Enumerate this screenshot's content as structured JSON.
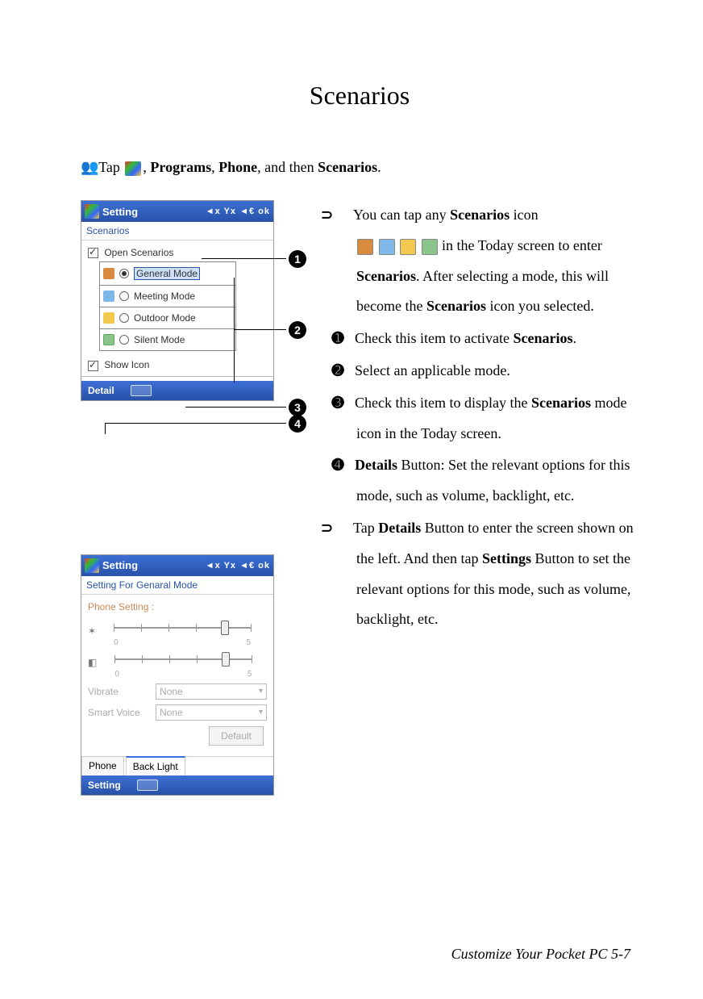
{
  "title": "Scenarios",
  "nav": {
    "tap": "Tap",
    "sep1": ", ",
    "programs": "Programs",
    "sep2": ", ",
    "phone": "Phone",
    "sep3": ", and then ",
    "scenarios": "Scenarios",
    "end": "."
  },
  "device1": {
    "topbar_title": "Setting",
    "tray": "◄x  Yx  ◄€  ok",
    "subhead": "Scenarios",
    "open_label": "Open Scenarios",
    "modes": {
      "general": "General Mode",
      "meeting": "Meeting Mode",
      "outdoor": "Outdoor Mode",
      "silent": "Silent Mode"
    },
    "show_icon": "Show  Icon",
    "detail_btn": "Detail"
  },
  "callouts": {
    "c1": "1",
    "c2": "2",
    "c3": "3",
    "c4": "4"
  },
  "device2": {
    "topbar_title": "Setting",
    "tray": "◄x  Yx  ◄€  ok",
    "subhead": "Setting For Genaral Mode",
    "section": "Phone Setting :",
    "scale_min": "0",
    "scale_max": "5",
    "vibrate_label": "Vibrate",
    "vibrate_value": "None",
    "smart_label": "Smart Voice",
    "smart_value": "None",
    "default_btn": "Default",
    "tab_phone": "Phone",
    "tab_backlight": "Back Light",
    "bottom_btn": "Setting"
  },
  "right": {
    "p_intro_a": "You can tap any ",
    "p_intro_b": "Scenarios",
    "p_intro_c": " icon",
    "p_intro_d": " in the Today screen to enter ",
    "p_intro_e": "Scenarios",
    "p_intro_f": ". After selecting a mode, this will become the ",
    "p_intro_g": "Scenarios",
    "p_intro_h": " icon you selected.",
    "n1_a": "Check this item to activate ",
    "n1_b": "Scenarios",
    "n1_c": ".",
    "n2": "Select an applicable mode.",
    "n3_a": "Check this item to display the ",
    "n3_b": "Scenarios",
    "n3_c": " mode icon in the Today screen.",
    "n4_a": "Details",
    "n4_b": " Button: Set the relevant options for this mode, such as volume, backlight, etc.",
    "p2_a": "Tap ",
    "p2_b": "Details",
    "p2_c": " Button to enter the screen shown on the left. And then tap ",
    "p2_d": "Settings",
    "p2_e": " Button to set the relevant options for this mode, such as volume, backlight, etc."
  },
  "footer": "Customize Your Pocket PC    5-7"
}
